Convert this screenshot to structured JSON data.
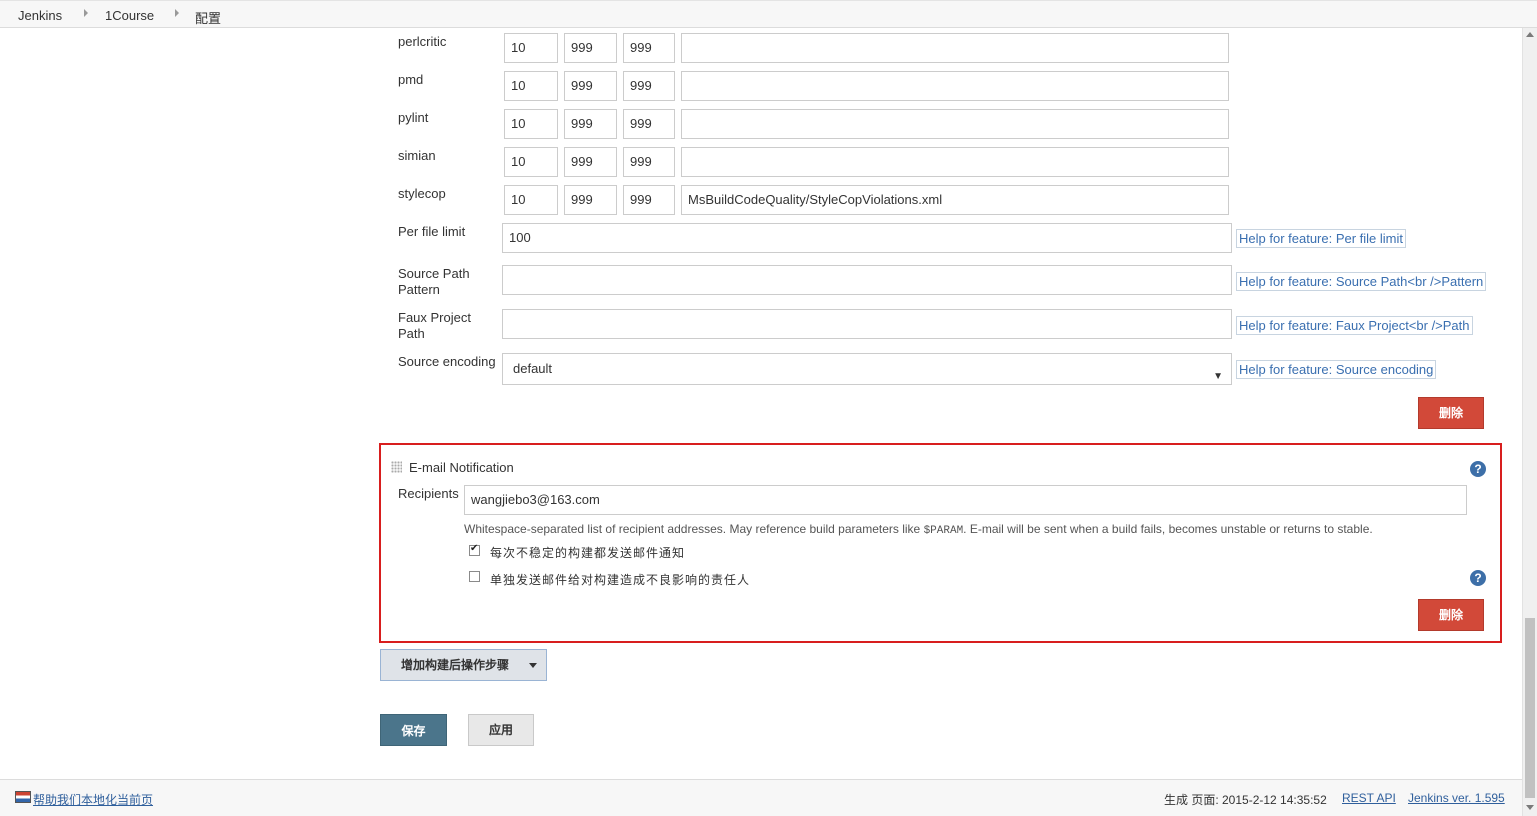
{
  "breadcrumb": {
    "items": [
      "Jenkins",
      "1Course",
      "配置"
    ]
  },
  "tools": [
    {
      "name": "perlcritic",
      "v1": "10",
      "v2": "999",
      "v3": "999",
      "pattern": ""
    },
    {
      "name": "pmd",
      "v1": "10",
      "v2": "999",
      "v3": "999",
      "pattern": ""
    },
    {
      "name": "pylint",
      "v1": "10",
      "v2": "999",
      "v3": "999",
      "pattern": ""
    },
    {
      "name": "simian",
      "v1": "10",
      "v2": "999",
      "v3": "999",
      "pattern": ""
    },
    {
      "name": "stylecop",
      "v1": "10",
      "v2": "999",
      "v3": "999",
      "pattern": "MsBuildCodeQuality/StyleCopViolations.xml"
    }
  ],
  "per_file_limit": {
    "label": "Per file limit",
    "value": "100",
    "help": "Help for feature: Per file limit"
  },
  "source_path_pattern": {
    "label_line1": "Source Path",
    "label_line2": "Pattern",
    "value": "",
    "help": "Help for feature: Source Path<br />Pattern"
  },
  "faux_project_path": {
    "label_line1": "Faux Project",
    "label_line2": "Path",
    "value": "",
    "help": "Help for feature: Faux Project<br />Path"
  },
  "source_encoding": {
    "label": "Source encoding",
    "value": "default",
    "help": "Help for feature: Source encoding"
  },
  "delete_label": "删除",
  "email": {
    "title": "E-mail Notification",
    "recipients_label": "Recipients",
    "recipients_value": "wangjiebo3@163.com",
    "desc_before": "Whitespace-separated list of recipient addresses. May reference build parameters like ",
    "desc_code": "$PARAM",
    "desc_after": ". E-mail will be sent when a build fails, becomes unstable or returns to stable.",
    "option1": "每次不稳定的构建都发送邮件通知",
    "option1_checked": true,
    "option2": "单独发送邮件给对构建造成不良影响的责任人",
    "option2_checked": false
  },
  "add_post_build": "增加构建后操作步骤",
  "save_label": "保存",
  "apply_label": "应用",
  "footer": {
    "localize_link": "帮助我们本地化当前页",
    "generated": "生成 页面: 2015-2-12 14:35:52",
    "rest_api": "REST API",
    "version": "Jenkins ver. 1.595"
  },
  "colors": {
    "danger": "#d24939",
    "save": "#4b758b",
    "highlight_border": "#d81e1e",
    "link": "#2f5f9c"
  }
}
